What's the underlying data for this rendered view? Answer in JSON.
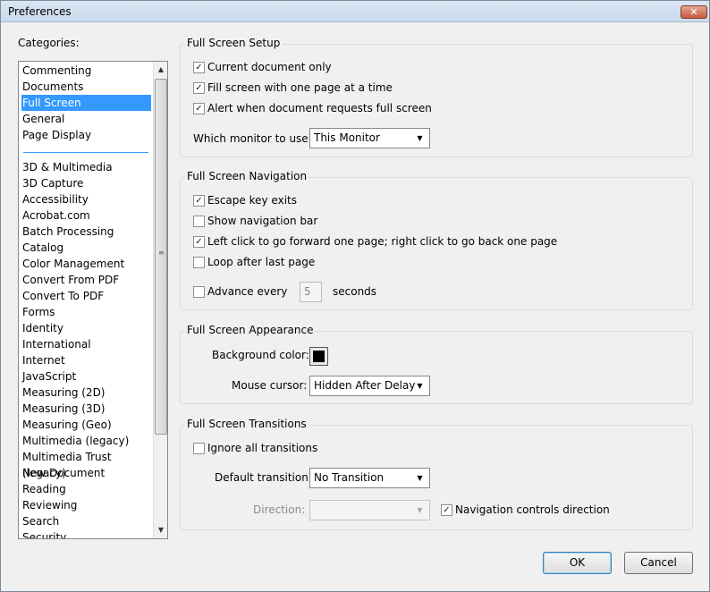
{
  "window": {
    "title": "Preferences",
    "close_label": "✕"
  },
  "categories": {
    "label": "Categories:",
    "top_items": [
      {
        "label": "Commenting"
      },
      {
        "label": "Documents"
      },
      {
        "label": "Full Screen",
        "selected": true
      },
      {
        "label": "General"
      },
      {
        "label": "Page Display"
      }
    ],
    "items": [
      {
        "label": "3D & Multimedia"
      },
      {
        "label": "3D Capture"
      },
      {
        "label": "Accessibility"
      },
      {
        "label": "Acrobat.com"
      },
      {
        "label": "Batch Processing"
      },
      {
        "label": "Catalog"
      },
      {
        "label": "Color Management"
      },
      {
        "label": "Convert From PDF"
      },
      {
        "label": "Convert To PDF"
      },
      {
        "label": "Forms"
      },
      {
        "label": "Identity"
      },
      {
        "label": "International"
      },
      {
        "label": "Internet"
      },
      {
        "label": "JavaScript"
      },
      {
        "label": "Measuring (2D)"
      },
      {
        "label": "Measuring (3D)"
      },
      {
        "label": "Measuring (Geo)"
      },
      {
        "label": "Multimedia (legacy)"
      },
      {
        "label": "Multimedia Trust (legacy)"
      },
      {
        "label": "New Document"
      },
      {
        "label": "Reading"
      },
      {
        "label": "Reviewing"
      },
      {
        "label": "Search"
      },
      {
        "label": "Security"
      }
    ]
  },
  "setup": {
    "title": "Full Screen Setup",
    "current_doc": {
      "label": "Current document only",
      "checked": true
    },
    "fill_screen": {
      "label": "Fill screen with one page at a time",
      "checked": true
    },
    "alert": {
      "label": "Alert when document requests full screen",
      "checked": true
    },
    "monitor_label": "Which monitor to use:",
    "monitor_value": "This Monitor"
  },
  "navigation": {
    "title": "Full Screen Navigation",
    "escape": {
      "label": "Escape key exits",
      "checked": true
    },
    "nav_bar": {
      "label": "Show navigation bar",
      "checked": false
    },
    "left_click": {
      "label": "Left click to go forward one page; right click to go back one page",
      "checked": true
    },
    "loop": {
      "label": "Loop after last page",
      "checked": false
    },
    "advance": {
      "label": "Advance every",
      "checked": false
    },
    "advance_value": "5",
    "seconds_label": "seconds"
  },
  "appearance": {
    "title": "Full Screen Appearance",
    "bg_label": "Background color:",
    "bg_color": "#000000",
    "cursor_label": "Mouse cursor:",
    "cursor_value": "Hidden After Delay"
  },
  "transitions": {
    "title": "Full Screen Transitions",
    "ignore": {
      "label": "Ignore all transitions",
      "checked": false
    },
    "default_label": "Default transition:",
    "default_value": "No Transition",
    "direction_label": "Direction:",
    "direction_value": "",
    "nav_controls": {
      "label": "Navigation controls direction",
      "checked": true
    }
  },
  "buttons": {
    "ok": "OK",
    "cancel": "Cancel"
  },
  "icons": {
    "check": "✓",
    "dropdown": "▼",
    "scroll_up": "▲",
    "scroll_down": "▼",
    "grip": "≡"
  }
}
